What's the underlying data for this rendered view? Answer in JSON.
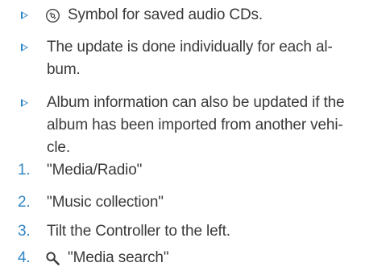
{
  "accent_color": "#2f86c5",
  "text_color": "#3a3a3a",
  "bullets": [
    {
      "icon": "audio-cd-icon",
      "text": "Symbol for saved audio CDs."
    },
    {
      "lines": [
        "The update is done individually for each al-",
        "bum."
      ]
    },
    {
      "lines": [
        "Album information can also be updated if the",
        "album has been imported from another vehi-",
        "cle."
      ]
    }
  ],
  "steps": [
    {
      "num": "1.",
      "text": "\"Media/Radio\""
    },
    {
      "num": "2.",
      "text": "\"Music collection\""
    },
    {
      "num": "3.",
      "text": "Tilt the Controller to the left."
    },
    {
      "num": "4.",
      "icon": "search-icon",
      "text": "\"Media search\""
    }
  ]
}
